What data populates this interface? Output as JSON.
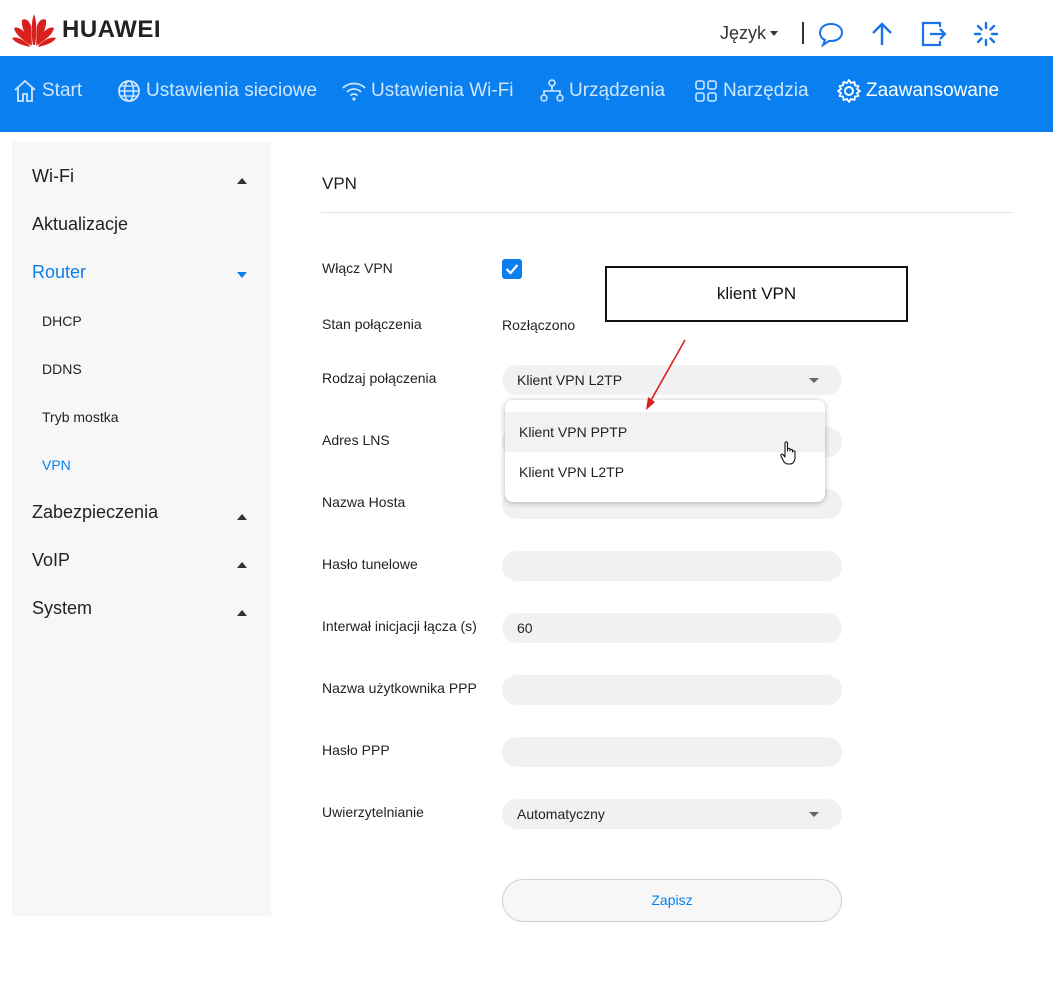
{
  "header": {
    "brand": "HUAWEI",
    "language_label": "Język",
    "icons": [
      "messages-icon",
      "upload-icon",
      "logout-icon",
      "loading-icon"
    ]
  },
  "nav": {
    "items": [
      {
        "label": "Start",
        "icon": "home-icon"
      },
      {
        "label": "Ustawienia sieciowe",
        "icon": "globe-icon"
      },
      {
        "label": "Ustawienia Wi-Fi",
        "icon": "wifi-icon"
      },
      {
        "label": "Urządzenia",
        "icon": "devices-icon"
      },
      {
        "label": "Narzędzia",
        "icon": "tools-icon"
      },
      {
        "label": "Zaawansowane",
        "icon": "gear-icon",
        "active": true
      }
    ]
  },
  "sidebar": {
    "sections": [
      {
        "label": "Wi-Fi",
        "expanded": false
      },
      {
        "label": "Aktualizacje"
      },
      {
        "label": "Router",
        "expanded": true,
        "active": true
      },
      {
        "label": "Zabezpieczenia",
        "expanded": false
      },
      {
        "label": "VoIP",
        "expanded": false
      },
      {
        "label": "System",
        "expanded": false
      }
    ],
    "router_sub": [
      "DHCP",
      "DDNS",
      "Tryb mostka",
      "VPN"
    ],
    "active_sub": "VPN"
  },
  "main": {
    "title": "VPN",
    "enable_vpn": {
      "label": "Włącz VPN",
      "checked": true
    },
    "status": {
      "label": "Stan połączenia",
      "value": "Rozłączono"
    },
    "connection_type": {
      "label": "Rodzaj połączenia",
      "value": "Klient VPN L2TP"
    },
    "lns_address": {
      "label": "Adres LNS",
      "value": ""
    },
    "host_name": {
      "label": "Nazwa Hosta",
      "value": ""
    },
    "tunnel_password": {
      "label": "Hasło tunelowe",
      "value": ""
    },
    "init_interval": {
      "label": "Interwał inicjacji łącza (s)",
      "value": "60"
    },
    "ppp_user": {
      "label": "Nazwa użytkownika PPP",
      "value": ""
    },
    "ppp_password": {
      "label": "Hasło PPP",
      "value": ""
    },
    "auth": {
      "label": "Uwierzytelnianie",
      "value": "Automatyczny"
    },
    "save_label": "Zapisz"
  },
  "dropdown": {
    "options": [
      "Klient VPN PPTP",
      "Klient VPN L2TP"
    ],
    "hovered_index": 0
  },
  "annotation": {
    "text": "klient VPN",
    "arrow_color": "#d9201c"
  },
  "colors": {
    "accent": "#0a7ff0",
    "nav_inactive": "#cfe6ff"
  }
}
